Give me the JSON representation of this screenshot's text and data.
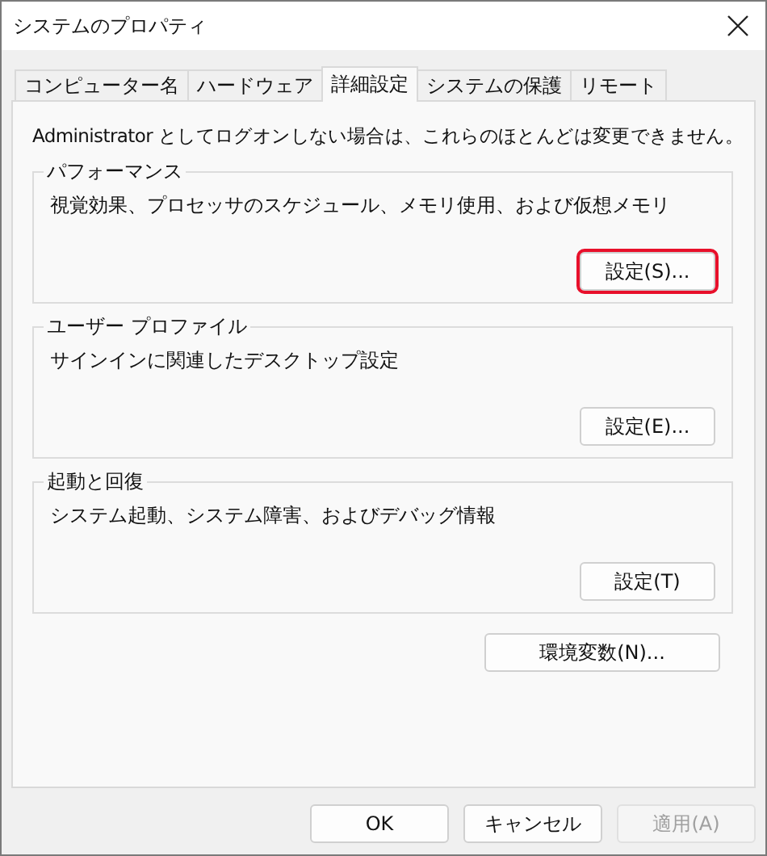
{
  "window": {
    "title": "システムのプロパティ"
  },
  "tabs": [
    {
      "label": "コンピューター名",
      "selected": false
    },
    {
      "label": "ハードウェア",
      "selected": false
    },
    {
      "label": "詳細設定",
      "selected": true
    },
    {
      "label": "システムの保護",
      "selected": false
    },
    {
      "label": "リモート",
      "selected": false
    }
  ],
  "notice": "Administrator としてログオンしない場合は、これらのほとんどは変更できません。",
  "groups": [
    {
      "title": "パフォーマンス",
      "description": "視覚効果、プロセッサのスケジュール、メモリ使用、および仮想メモリ",
      "button": "設定(S)...",
      "highlighted": true
    },
    {
      "title": "ユーザー プロファイル",
      "description": "サインインに関連したデスクトップ設定",
      "button": "設定(E)...",
      "highlighted": false
    },
    {
      "title": "起動と回復",
      "description": "システム起動、システム障害、およびデバッグ情報",
      "button": "設定(T)",
      "highlighted": false
    }
  ],
  "environment_button": "環境変数(N)...",
  "buttons": [
    {
      "label": "OK",
      "disabled": false
    },
    {
      "label": "キャンセル",
      "disabled": false
    },
    {
      "label": "適用(A)",
      "disabled": true
    }
  ]
}
